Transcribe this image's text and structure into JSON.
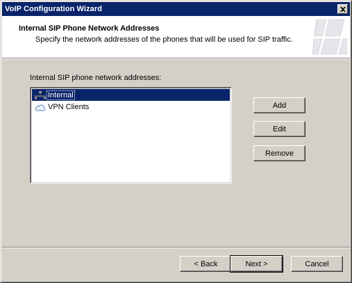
{
  "window": {
    "title": "VoIP Configuration Wizard"
  },
  "header": {
    "title": "Internal SIP Phone Network Addresses",
    "subtitle": "Specify the network addresses of the phones that will be used for SIP traffic."
  },
  "list": {
    "label": "Internal SIP phone network addresses:",
    "items": [
      {
        "label": "Internal",
        "icon": "network-icon",
        "selected": true
      },
      {
        "label": "VPN Clients",
        "icon": "cloud-icon",
        "selected": false
      }
    ]
  },
  "side_buttons": {
    "add": "Add",
    "edit": "Edit",
    "remove": "Remove"
  },
  "footer": {
    "back": "< Back",
    "next": "Next >",
    "cancel": "Cancel"
  },
  "colors": {
    "titlebar": "#0a246a",
    "selection": "#0a246a",
    "face": "#d4d0c8"
  }
}
